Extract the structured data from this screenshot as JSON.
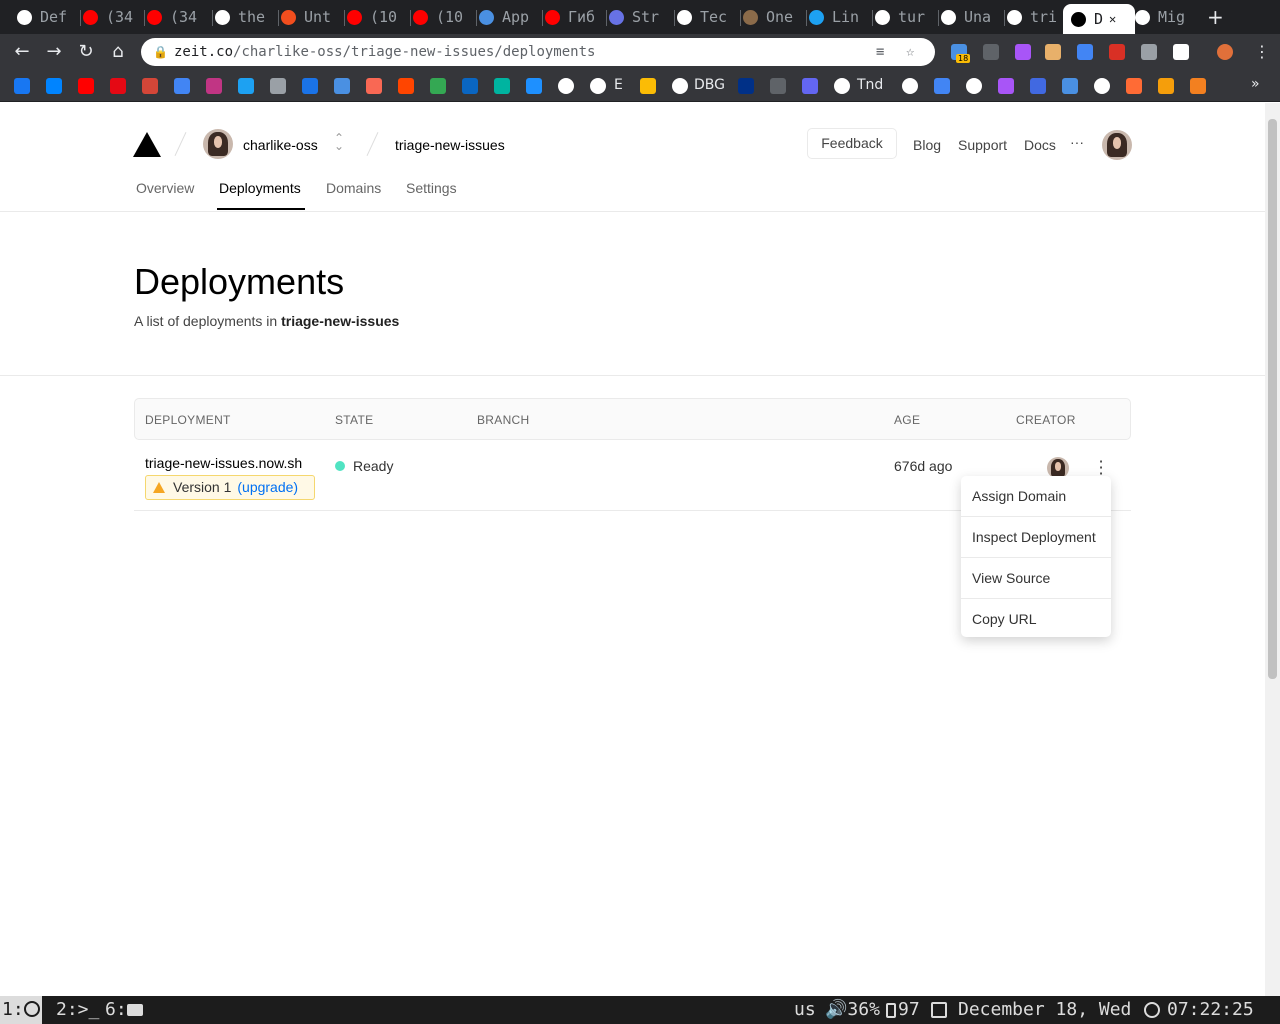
{
  "browser": {
    "tabs": [
      {
        "label": "Def",
        "icon": "github-icon",
        "color": "#ffffff"
      },
      {
        "label": "(34",
        "icon": "youtube-icon",
        "color": "#ff0000"
      },
      {
        "label": "(34",
        "icon": "youtube-icon",
        "color": "#ff0000"
      },
      {
        "label": "the",
        "icon": "github-icon",
        "color": "#ffffff"
      },
      {
        "label": "Unt",
        "icon": "figma-icon",
        "color": "#f24e1e"
      },
      {
        "label": "(10",
        "icon": "youtube-icon",
        "color": "#ff0000"
      },
      {
        "label": "(10",
        "icon": "youtube-icon",
        "color": "#ff0000"
      },
      {
        "label": "App",
        "icon": "app-icon",
        "color": "#4a90e2"
      },
      {
        "label": "Гиб",
        "icon": "youtube-icon",
        "color": "#ff0000"
      },
      {
        "label": "Str",
        "icon": "stripe-icon",
        "color": "#6772e5"
      },
      {
        "label": "Tec",
        "icon": "globe-icon",
        "color": "#ffffff"
      },
      {
        "label": "One",
        "icon": "avatar-icon",
        "color": "#8b6b4a"
      },
      {
        "label": "Lin",
        "icon": "twitter-icon",
        "color": "#1da1f2"
      },
      {
        "label": "tur",
        "icon": "github-icon",
        "color": "#ffffff"
      },
      {
        "label": "Una",
        "icon": "github-icon",
        "color": "#ffffff"
      },
      {
        "label": "tri",
        "icon": "github-icon",
        "color": "#ffffff"
      },
      {
        "label": "D",
        "icon": "zeit-icon",
        "color": "#000000",
        "active": true
      },
      {
        "label": "Mig",
        "icon": "zeit-icon",
        "color": "#ffffff"
      }
    ],
    "url_host": "zeit.co",
    "url_path": "/charlike-oss/triage-new-issues/deployments",
    "extension_badge": "18",
    "bookmark_labels": {
      "e": "E",
      "dbg": "DBG",
      "tnd": "Tnd"
    }
  },
  "header": {
    "team": "charlike-oss",
    "project": "triage-new-issues",
    "feedback_label": "Feedback",
    "links": [
      "Blog",
      "Support",
      "Docs"
    ],
    "more_label": "···"
  },
  "subnav": {
    "tabs": [
      "Overview",
      "Deployments",
      "Domains",
      "Settings"
    ],
    "active": "Deployments"
  },
  "main": {
    "title": "Deployments",
    "subtitle_prefix": "A list of deployments in ",
    "subtitle_project": "triage-new-issues"
  },
  "table": {
    "columns": [
      "DEPLOYMENT",
      "STATE",
      "BRANCH",
      "AGE",
      "CREATOR"
    ],
    "rows": [
      {
        "deployment": "triage-new-issues.now.sh",
        "version": "Version 1",
        "upgrade": "(upgrade)",
        "state": "Ready",
        "branch": "",
        "age": "676d ago"
      }
    ]
  },
  "context_menu": {
    "items": [
      "Assign Domain",
      "Inspect Deployment",
      "View Source",
      "Copy URL"
    ]
  },
  "statusbar": {
    "ws1": "1:",
    "ws2": "2:>_",
    "ws6": "6:",
    "layout": "us",
    "volume": "🔊36%",
    "battery": "97",
    "date": "December 18, Wed",
    "time": "07:22:25"
  },
  "colors": {
    "ready": "#50e3c2",
    "link": "#0070f3",
    "warning": "#f5a623"
  }
}
